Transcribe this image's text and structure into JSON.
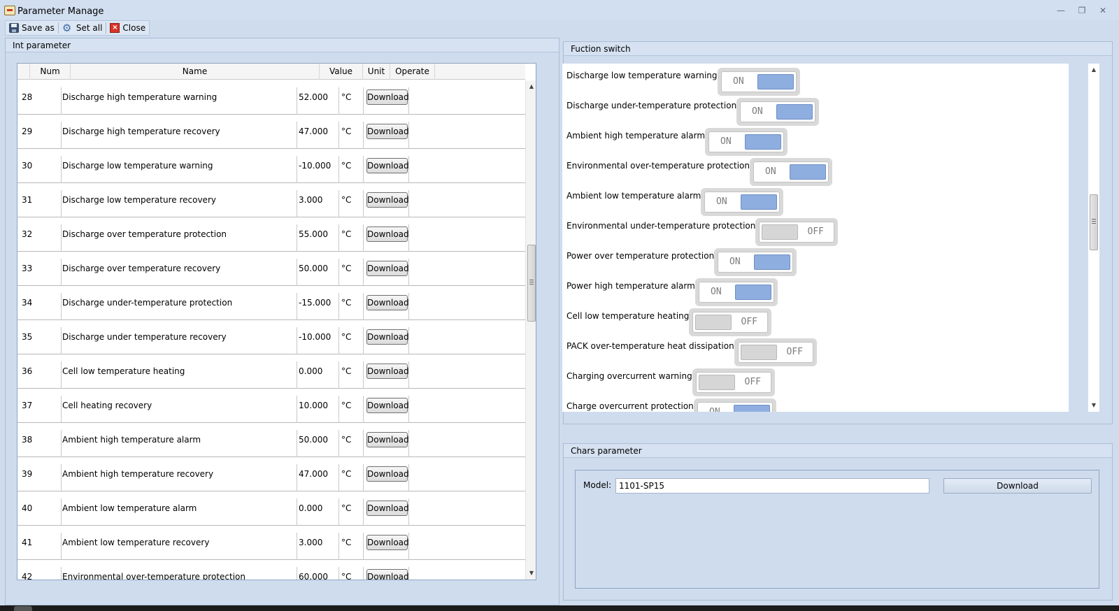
{
  "window": {
    "title": "Parameter Manage"
  },
  "toolbar": {
    "save_as": "Save as",
    "set_all": "Set all",
    "close": "Close"
  },
  "int_panel": {
    "title": "Int parameter",
    "columns": [
      "Num",
      "Name",
      "Value",
      "Unit",
      "Operate"
    ],
    "button_label": "Download",
    "rows": [
      {
        "num": "28",
        "name": "Discharge high temperature warning",
        "value": "52.000",
        "unit": "°C"
      },
      {
        "num": "29",
        "name": "Discharge high temperature recovery",
        "value": "47.000",
        "unit": "°C"
      },
      {
        "num": "30",
        "name": "Discharge low temperature warning",
        "value": "-10.000",
        "unit": "°C"
      },
      {
        "num": "31",
        "name": "Discharge low temperature recovery",
        "value": "3.000",
        "unit": "°C"
      },
      {
        "num": "32",
        "name": "Discharge over temperature protection",
        "value": "55.000",
        "unit": "°C"
      },
      {
        "num": "33",
        "name": "Discharge over temperature recovery",
        "value": "50.000",
        "unit": "°C"
      },
      {
        "num": "34",
        "name": "Discharge under-temperature protection",
        "value": "-15.000",
        "unit": "°C"
      },
      {
        "num": "35",
        "name": "Discharge under temperature recovery",
        "value": "-10.000",
        "unit": "°C"
      },
      {
        "num": "36",
        "name": "Cell low temperature heating",
        "value": "0.000",
        "unit": "°C"
      },
      {
        "num": "37",
        "name": "Cell heating recovery",
        "value": "10.000",
        "unit": "°C"
      },
      {
        "num": "38",
        "name": "Ambient high temperature alarm",
        "value": "50.000",
        "unit": "°C"
      },
      {
        "num": "39",
        "name": "Ambient high temperature recovery",
        "value": "47.000",
        "unit": "°C"
      },
      {
        "num": "40",
        "name": "Ambient low temperature alarm",
        "value": "0.000",
        "unit": "°C"
      },
      {
        "num": "41",
        "name": "Ambient low temperature recovery",
        "value": "3.000",
        "unit": "°C"
      },
      {
        "num": "42",
        "name": "Environmental over-temperature protection",
        "value": "60.000",
        "unit": "°C"
      }
    ]
  },
  "switch_panel": {
    "title": "Fuction switch",
    "on_label": "ON",
    "off_label": "OFF",
    "items": [
      {
        "label": "Discharge low temperature warning",
        "on": true
      },
      {
        "label": "Discharge under-temperature protection",
        "on": true
      },
      {
        "label": "Ambient high temperature alarm",
        "on": true
      },
      {
        "label": "Environmental over-temperature protection",
        "on": true
      },
      {
        "label": "Ambient low temperature alarm",
        "on": true
      },
      {
        "label": "Environmental under-temperature protection",
        "on": false
      },
      {
        "label": "Power over temperature protection",
        "on": true
      },
      {
        "label": "Power high temperature alarm",
        "on": true
      },
      {
        "label": "Cell low temperature heating",
        "on": false
      },
      {
        "label": "PACK over-temperature heat dissipation",
        "on": false
      },
      {
        "label": "Charging overcurrent warning",
        "on": false
      },
      {
        "label": "Charge overcurrent protection",
        "on": true
      }
    ]
  },
  "chars_panel": {
    "title": "Chars parameter",
    "model_label": "Model:",
    "model_value": "1101-SP15",
    "button_label": "Download"
  },
  "colors": {
    "switch_on": "#8faee0",
    "switch_off": "#d6d6d6",
    "background": "#cfdcee"
  }
}
